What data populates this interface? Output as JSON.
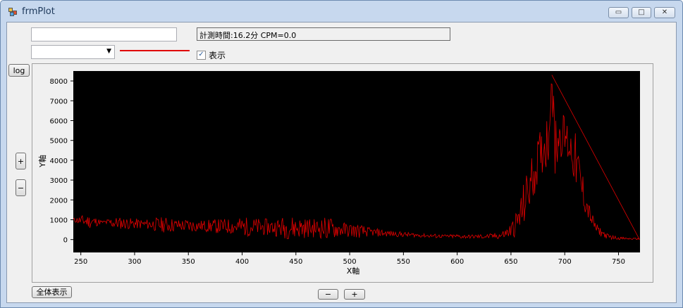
{
  "window": {
    "title": "frmPlot",
    "minimize_glyph": "▭",
    "maximize_glyph": "□",
    "close_glyph": "✕"
  },
  "controls": {
    "text_input_value": "",
    "combo_value": "",
    "combo_arrow": "▼",
    "status_text": "計測時間:16.2分  CPM=0.0",
    "checkbox_label": "表示",
    "checkbox_checked": true,
    "checkbox_mark": "✓",
    "log_button": "log",
    "y_zoom_in": "+",
    "y_zoom_out": "−",
    "show_all_button": "全体表示",
    "x_zoom_out": "−",
    "x_zoom_in": "+"
  },
  "colors": {
    "plot_background": "#000000",
    "series": "#e00000",
    "series_swatch": "#e00000"
  },
  "chart_data": {
    "type": "line",
    "xlabel": "X軸",
    "ylabel": "Y軸",
    "xlim": [
      243,
      770
    ],
    "ylim": [
      -650,
      8500
    ],
    "x_ticks": [
      250,
      300,
      350,
      400,
      450,
      500,
      550,
      600,
      650,
      700,
      750
    ],
    "y_ticks": [
      0,
      1000,
      2000,
      3000,
      4000,
      5000,
      6000,
      7000,
      8000
    ],
    "grid": false,
    "series": [
      {
        "color": "#e00000",
        "x": [
          243,
          250,
          260,
          270,
          280,
          290,
          300,
          310,
          320,
          330,
          340,
          350,
          360,
          370,
          380,
          390,
          400,
          410,
          420,
          430,
          440,
          450,
          460,
          470,
          480,
          490,
          500,
          510,
          520,
          530,
          540,
          550,
          560,
          570,
          580,
          590,
          600,
          610,
          620,
          630,
          640,
          645,
          650,
          655,
          660,
          665,
          670,
          675,
          680,
          685,
          688,
          690,
          695,
          700,
          705,
          710,
          715,
          720,
          725,
          730,
          740,
          750,
          760,
          770
        ],
        "y": [
          1000,
          950,
          900,
          880,
          850,
          820,
          800,
          780,
          760,
          740,
          720,
          700,
          690,
          680,
          670,
          660,
          650,
          640,
          630,
          620,
          610,
          600,
          590,
          580,
          560,
          520,
          480,
          420,
          380,
          330,
          290,
          260,
          230,
          200,
          180,
          170,
          160,
          150,
          150,
          160,
          200,
          300,
          450,
          800,
          1400,
          2300,
          3100,
          4000,
          4600,
          5200,
          8300,
          4900,
          5300,
          5200,
          4700,
          4000,
          2800,
          1800,
          1000,
          500,
          150,
          70,
          40,
          30
        ],
        "peak_values": [
          1100,
          1250,
          1300,
          950,
          1200,
          1150,
          1100,
          1050,
          1150,
          1200,
          1050,
          1100,
          1000,
          1050,
          1100,
          1100,
          1200,
          1150,
          1100,
          1100,
          1250,
          1250,
          1150,
          1100,
          1250,
          950,
          900,
          800,
          600,
          550,
          450,
          400,
          350,
          300,
          300,
          250,
          300,
          250,
          280,
          300,
          400,
          600,
          900,
          1500,
          2600,
          3600,
          4500,
          5300,
          6000,
          6800,
          8300,
          7500,
          6500,
          6500,
          6000,
          5500,
          4100,
          2500,
          1400,
          800,
          300,
          150,
          90,
          70
        ]
      }
    ]
  }
}
